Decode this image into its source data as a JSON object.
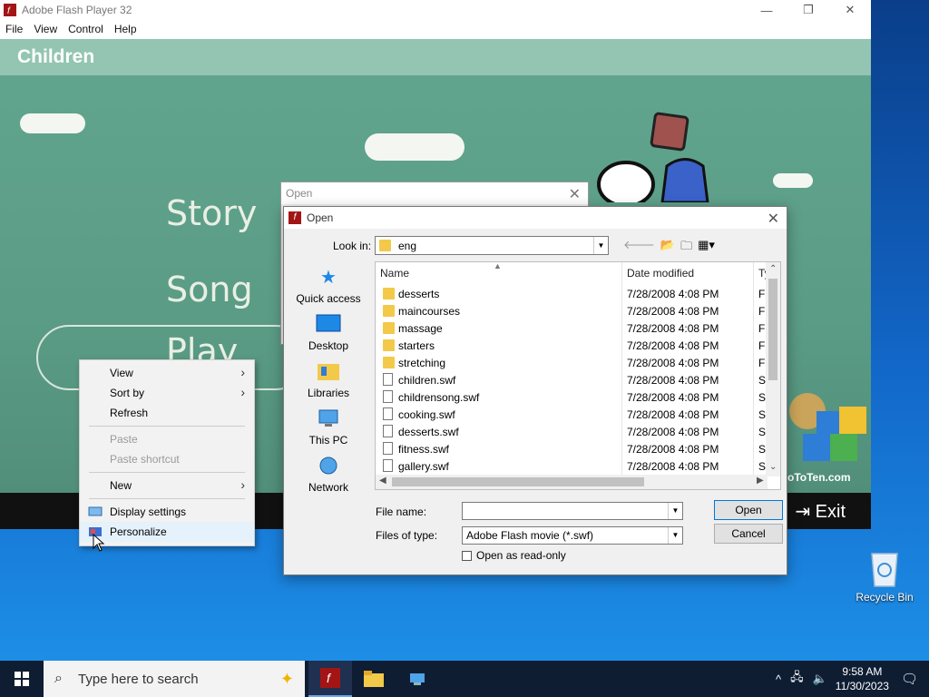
{
  "flash_window": {
    "title": "Adobe Flash Player 32",
    "menu": [
      "File",
      "View",
      "Control",
      "Help"
    ],
    "stage": {
      "header": "Children",
      "menu_items": [
        "Story",
        "Song",
        "Play"
      ],
      "exit_label": "Exit",
      "logo_text": "oToTen.com"
    }
  },
  "open_dialog_back": {
    "title": "Open"
  },
  "open_dialog": {
    "title": "Open",
    "look_in_label": "Look in:",
    "look_in_value": "eng",
    "places": [
      "Quick access",
      "Desktop",
      "Libraries",
      "This PC",
      "Network"
    ],
    "columns": {
      "name": "Name",
      "date": "Date modified",
      "type": "Ty"
    },
    "files": [
      {
        "name": "desserts",
        "date": "7/28/2008 4:08 PM",
        "type": "Fil",
        "kind": "folder"
      },
      {
        "name": "maincourses",
        "date": "7/28/2008 4:08 PM",
        "type": "Fil",
        "kind": "folder"
      },
      {
        "name": "massage",
        "date": "7/28/2008 4:08 PM",
        "type": "Fil",
        "kind": "folder"
      },
      {
        "name": "starters",
        "date": "7/28/2008 4:08 PM",
        "type": "Fil",
        "kind": "folder"
      },
      {
        "name": "stretching",
        "date": "7/28/2008 4:08 PM",
        "type": "Fil",
        "kind": "folder"
      },
      {
        "name": "children.swf",
        "date": "7/28/2008 4:08 PM",
        "type": "SV",
        "kind": "file"
      },
      {
        "name": "childrensong.swf",
        "date": "7/28/2008 4:08 PM",
        "type": "SV",
        "kind": "file"
      },
      {
        "name": "cooking.swf",
        "date": "7/28/2008 4:08 PM",
        "type": "SV",
        "kind": "file"
      },
      {
        "name": "desserts.swf",
        "date": "7/28/2008 4:08 PM",
        "type": "SV",
        "kind": "file"
      },
      {
        "name": "fitness.swf",
        "date": "7/28/2008 4:08 PM",
        "type": "SV",
        "kind": "file"
      },
      {
        "name": "gallery.swf",
        "date": "7/28/2008 4:08 PM",
        "type": "SV",
        "kind": "file"
      }
    ],
    "file_name_label": "File name:",
    "file_name_value": "",
    "files_of_type_label": "Files of type:",
    "files_of_type_value": "Adobe Flash movie (*.swf)",
    "open_button": "Open",
    "cancel_button": "Cancel",
    "readonly_label": "Open as read-only"
  },
  "context_menu": {
    "items": [
      {
        "label": "View",
        "submenu": true,
        "disabled": false
      },
      {
        "label": "Sort by",
        "submenu": true,
        "disabled": false
      },
      {
        "label": "Refresh",
        "submenu": false,
        "disabled": false
      },
      {
        "label": "Paste",
        "submenu": false,
        "disabled": true
      },
      {
        "label": "Paste shortcut",
        "submenu": false,
        "disabled": true
      },
      {
        "label": "New",
        "submenu": true,
        "disabled": false
      },
      {
        "label": "Display settings",
        "submenu": false,
        "disabled": false
      },
      {
        "label": "Personalize",
        "submenu": false,
        "disabled": false
      }
    ]
  },
  "desktop": {
    "recycle_bin": "Recycle Bin"
  },
  "taskbar": {
    "search_placeholder": "Type here to search",
    "time": "9:58 AM",
    "date": "11/30/2023"
  }
}
